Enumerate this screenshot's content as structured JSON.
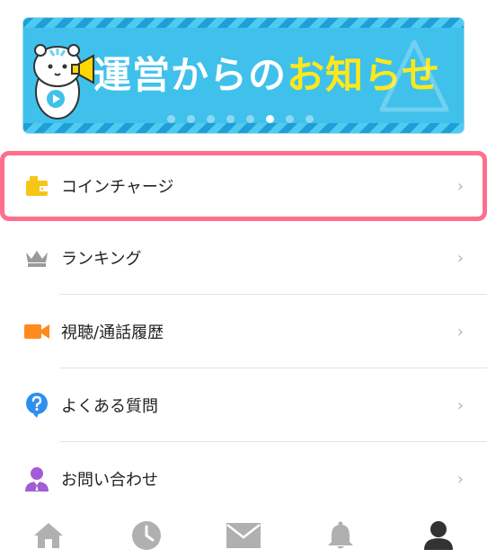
{
  "banner": {
    "title_white": "運営からの",
    "title_yellow": "お知らせ",
    "dots_count": 8,
    "active_dot": 5
  },
  "menu": {
    "items": [
      {
        "label": "コインチャージ",
        "icon": "wallet-icon",
        "color": "#f6c518"
      },
      {
        "label": "ランキング",
        "icon": "crown-icon",
        "color": "#9a9a9a"
      },
      {
        "label": "視聴/通話履歴",
        "icon": "video-camera-icon",
        "color": "#ff8a1e"
      },
      {
        "label": "よくある質問",
        "icon": "question-icon",
        "color": "#2f8ff0"
      },
      {
        "label": "お問い合わせ",
        "icon": "support-person-icon",
        "color": "#a35cd6"
      }
    ],
    "chevron": "›"
  },
  "tabbar": {
    "tabs": [
      {
        "icon": "home-icon",
        "active": false
      },
      {
        "icon": "clock-icon",
        "active": false
      },
      {
        "icon": "mail-icon",
        "active": false
      },
      {
        "icon": "bell-icon",
        "active": false
      },
      {
        "icon": "user-icon",
        "active": true
      }
    ],
    "inactive_color": "#b0b0b0",
    "active_color": "#333333"
  },
  "colors": {
    "highlight_border": "#ff6e8e",
    "banner_bg": "#3fc1ec"
  }
}
